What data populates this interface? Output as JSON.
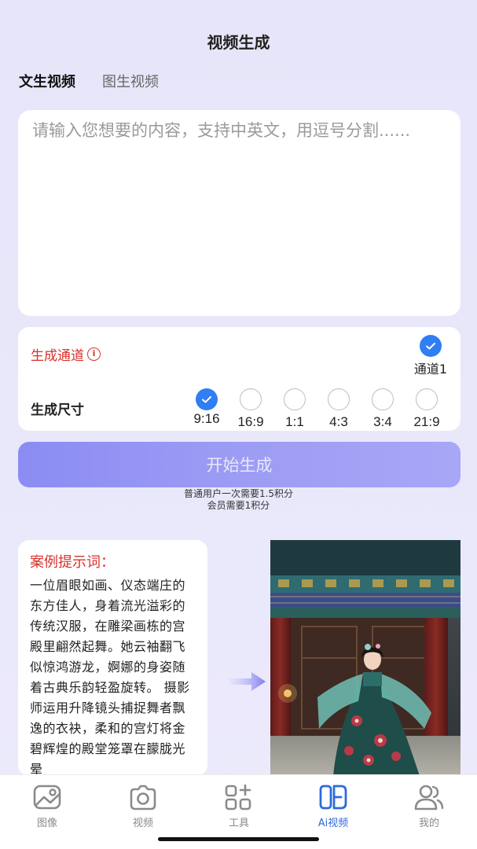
{
  "header": {
    "title": "视频生成"
  },
  "tabs": [
    {
      "label": "文生视频",
      "active": true
    },
    {
      "label": "图生视频",
      "active": false
    }
  ],
  "prompt": {
    "placeholder": "请输入您想要的内容，支持中英文，用逗号分割......",
    "value": ""
  },
  "options": {
    "channel_label": "生成通道",
    "channel_info_icon": "info-icon",
    "channel": {
      "label": "通道1",
      "selected": true
    },
    "size_label": "生成尺寸",
    "sizes": [
      {
        "label": "9:16",
        "selected": true
      },
      {
        "label": "16:9",
        "selected": false
      },
      {
        "label": "1:1",
        "selected": false
      },
      {
        "label": "4:3",
        "selected": false
      },
      {
        "label": "3:4",
        "selected": false
      },
      {
        "label": "21:9",
        "selected": false
      }
    ]
  },
  "start_button": {
    "label": "开始生成"
  },
  "cost": {
    "line1": "普通用户一次需要1.5积分",
    "line2": "会员需要1积分"
  },
  "example": {
    "title": "案例提示词：",
    "text": "一位眉眼如画、仪态端庄的东方佳人，身着流光溢彩的传统汉服，在雕梁画栋的宫殿里翩然起舞。她云袖翻飞似惊鸿游龙，婀娜的身姿随着古典乐韵轻盈旋转。 摄影师运用升降镜头捕捉舞者飘逸的衣袂，柔和的宫灯将金碧辉煌的殿堂笼罩在朦胧光晕",
    "arrow_icon": "arrow-right-icon",
    "image": "example-video-thumbnail"
  },
  "tabbar": [
    {
      "label": "图像",
      "icon": "image-icon",
      "active": false
    },
    {
      "label": "视频",
      "icon": "camera-icon",
      "active": false
    },
    {
      "label": "工具",
      "icon": "tools-grid-icon",
      "active": false
    },
    {
      "label": "Ai视频",
      "icon": "ai-video-icon",
      "active": true
    },
    {
      "label": "我的",
      "icon": "user-icon",
      "active": false
    }
  ],
  "colors": {
    "accent_red": "#d7322c",
    "accent_blue": "#2f7ef3",
    "button_purple": "#9d9cf4",
    "active_tab": "#2e6bd6"
  }
}
